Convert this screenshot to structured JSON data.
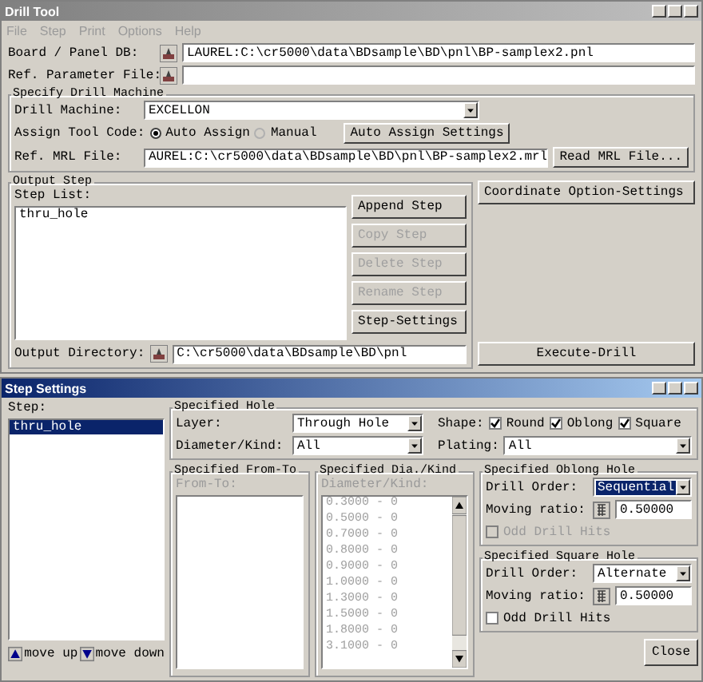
{
  "drill_tool": {
    "title": "Drill Tool",
    "active": false,
    "menu": [
      {
        "label": "File",
        "disabled": true
      },
      {
        "label": "Step",
        "disabled": true
      },
      {
        "label": "Print",
        "disabled": true
      },
      {
        "label": "Options",
        "disabled": true
      },
      {
        "label": "Help",
        "disabled": true
      }
    ],
    "board_db": {
      "label": "Board / Panel DB:",
      "value": "LAUREL:C:\\cr5000\\data\\BDsample\\BD\\pnl\\BP-samplex2.pnl"
    },
    "ref_param": {
      "label": "Ref. Parameter File:"
    },
    "machine": {
      "title": "Specify Drill Machine",
      "drill_machine": {
        "label": "Drill Machine:",
        "value": "EXCELLON"
      },
      "assign": {
        "label": "Assign Tool Code:",
        "options": [
          {
            "label": "Auto Assign",
            "selected": true
          },
          {
            "label": "Manual",
            "selected": false
          }
        ]
      },
      "auto_assign_button": "Auto Assign Settings",
      "mrl": {
        "label": "Ref. MRL File:",
        "value": "AUREL:C:\\cr5000\\data\\BDsample\\BD\\pnl\\BP-samplex2.mrl",
        "button": "Read MRL File..."
      }
    },
    "output_step": {
      "title": "Output Step",
      "list_label": "Step List:",
      "steps": [
        {
          "label": "thru_hole",
          "selected": false
        }
      ],
      "buttons": [
        {
          "label": "Append Step",
          "disabled": false
        },
        {
          "label": "Copy Step",
          "disabled": true
        },
        {
          "label": "Delete Step",
          "disabled": true
        },
        {
          "label": "Rename Step",
          "disabled": true
        },
        {
          "label": "Step-Settings",
          "disabled": false
        }
      ],
      "output_dir": {
        "label": "Output Directory:",
        "value": "C:\\cr5000\\data\\BDsample\\BD\\pnl"
      }
    },
    "coordinate_button": "Coordinate Option-Settings",
    "execute_button": "Execute-Drill"
  },
  "step_settings": {
    "title": "Step Settings",
    "active": true,
    "step_label": "Step:",
    "steps": [
      {
        "label": "thru_hole",
        "selected": true
      }
    ],
    "move_up": "move up",
    "move_down": "move down",
    "hole": {
      "title": "Specified Hole",
      "layer": {
        "label": "Layer:",
        "value": "Through Hole"
      },
      "diameter": {
        "label": "Diameter/Kind:",
        "value": "All"
      },
      "shape_label": "Shape:",
      "shapes": [
        {
          "label": "Round",
          "checked": true
        },
        {
          "label": "Oblong",
          "checked": true
        },
        {
          "label": "Square",
          "checked": true
        }
      ],
      "plating": {
        "label": "Plating:",
        "value": "All"
      }
    },
    "from_to": {
      "title": "Specified From-To",
      "label": "From-To:",
      "disabled": true
    },
    "dia_kind": {
      "title": "Specified Dia./Kind",
      "label": "Diameter/Kind:",
      "disabled": true,
      "items": [
        "0.3000 - 0",
        "0.5000 - 0",
        "0.7000 - 0",
        "0.8000 - 0",
        "0.9000 - 0",
        "1.0000 - 0",
        "1.3000 - 0",
        "1.5000 - 0",
        "1.8000 - 0",
        "3.1000 - 0"
      ]
    },
    "oblong": {
      "title": "Specified Oblong Hole",
      "drill_order": {
        "label": "Drill Order:",
        "value": "Sequential",
        "highlighted": true
      },
      "moving_ratio": {
        "label": "Moving ratio:",
        "value": "0.50000"
      },
      "odd": {
        "label": "Odd Drill Hits",
        "checked": false,
        "disabled": true
      }
    },
    "square": {
      "title": "Specified Square Hole",
      "drill_order": {
        "label": "Drill Order:",
        "value": "Alternate",
        "highlighted": false
      },
      "moving_ratio": {
        "label": "Moving ratio:",
        "value": "0.50000"
      },
      "odd": {
        "label": "Odd Drill Hits",
        "checked": false,
        "disabled": false
      }
    },
    "close_button": "Close"
  }
}
